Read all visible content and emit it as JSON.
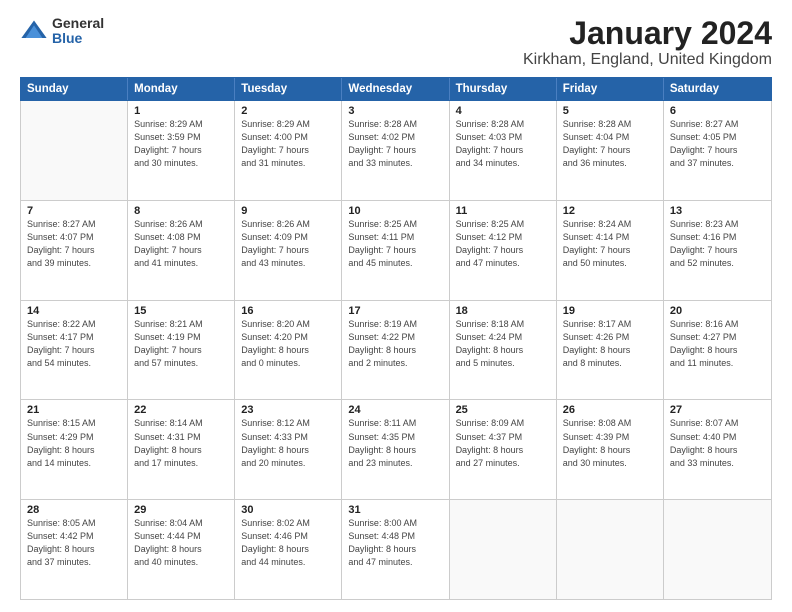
{
  "logo": {
    "general": "General",
    "blue": "Blue"
  },
  "title": "January 2024",
  "subtitle": "Kirkham, England, United Kingdom",
  "header_days": [
    "Sunday",
    "Monday",
    "Tuesday",
    "Wednesday",
    "Thursday",
    "Friday",
    "Saturday"
  ],
  "rows": [
    [
      {
        "day": "",
        "lines": []
      },
      {
        "day": "1",
        "lines": [
          "Sunrise: 8:29 AM",
          "Sunset: 3:59 PM",
          "Daylight: 7 hours",
          "and 30 minutes."
        ]
      },
      {
        "day": "2",
        "lines": [
          "Sunrise: 8:29 AM",
          "Sunset: 4:00 PM",
          "Daylight: 7 hours",
          "and 31 minutes."
        ]
      },
      {
        "day": "3",
        "lines": [
          "Sunrise: 8:28 AM",
          "Sunset: 4:02 PM",
          "Daylight: 7 hours",
          "and 33 minutes."
        ]
      },
      {
        "day": "4",
        "lines": [
          "Sunrise: 8:28 AM",
          "Sunset: 4:03 PM",
          "Daylight: 7 hours",
          "and 34 minutes."
        ]
      },
      {
        "day": "5",
        "lines": [
          "Sunrise: 8:28 AM",
          "Sunset: 4:04 PM",
          "Daylight: 7 hours",
          "and 36 minutes."
        ]
      },
      {
        "day": "6",
        "lines": [
          "Sunrise: 8:27 AM",
          "Sunset: 4:05 PM",
          "Daylight: 7 hours",
          "and 37 minutes."
        ]
      }
    ],
    [
      {
        "day": "7",
        "lines": [
          "Sunrise: 8:27 AM",
          "Sunset: 4:07 PM",
          "Daylight: 7 hours",
          "and 39 minutes."
        ]
      },
      {
        "day": "8",
        "lines": [
          "Sunrise: 8:26 AM",
          "Sunset: 4:08 PM",
          "Daylight: 7 hours",
          "and 41 minutes."
        ]
      },
      {
        "day": "9",
        "lines": [
          "Sunrise: 8:26 AM",
          "Sunset: 4:09 PM",
          "Daylight: 7 hours",
          "and 43 minutes."
        ]
      },
      {
        "day": "10",
        "lines": [
          "Sunrise: 8:25 AM",
          "Sunset: 4:11 PM",
          "Daylight: 7 hours",
          "and 45 minutes."
        ]
      },
      {
        "day": "11",
        "lines": [
          "Sunrise: 8:25 AM",
          "Sunset: 4:12 PM",
          "Daylight: 7 hours",
          "and 47 minutes."
        ]
      },
      {
        "day": "12",
        "lines": [
          "Sunrise: 8:24 AM",
          "Sunset: 4:14 PM",
          "Daylight: 7 hours",
          "and 50 minutes."
        ]
      },
      {
        "day": "13",
        "lines": [
          "Sunrise: 8:23 AM",
          "Sunset: 4:16 PM",
          "Daylight: 7 hours",
          "and 52 minutes."
        ]
      }
    ],
    [
      {
        "day": "14",
        "lines": [
          "Sunrise: 8:22 AM",
          "Sunset: 4:17 PM",
          "Daylight: 7 hours",
          "and 54 minutes."
        ]
      },
      {
        "day": "15",
        "lines": [
          "Sunrise: 8:21 AM",
          "Sunset: 4:19 PM",
          "Daylight: 7 hours",
          "and 57 minutes."
        ]
      },
      {
        "day": "16",
        "lines": [
          "Sunrise: 8:20 AM",
          "Sunset: 4:20 PM",
          "Daylight: 8 hours",
          "and 0 minutes."
        ]
      },
      {
        "day": "17",
        "lines": [
          "Sunrise: 8:19 AM",
          "Sunset: 4:22 PM",
          "Daylight: 8 hours",
          "and 2 minutes."
        ]
      },
      {
        "day": "18",
        "lines": [
          "Sunrise: 8:18 AM",
          "Sunset: 4:24 PM",
          "Daylight: 8 hours",
          "and 5 minutes."
        ]
      },
      {
        "day": "19",
        "lines": [
          "Sunrise: 8:17 AM",
          "Sunset: 4:26 PM",
          "Daylight: 8 hours",
          "and 8 minutes."
        ]
      },
      {
        "day": "20",
        "lines": [
          "Sunrise: 8:16 AM",
          "Sunset: 4:27 PM",
          "Daylight: 8 hours",
          "and 11 minutes."
        ]
      }
    ],
    [
      {
        "day": "21",
        "lines": [
          "Sunrise: 8:15 AM",
          "Sunset: 4:29 PM",
          "Daylight: 8 hours",
          "and 14 minutes."
        ]
      },
      {
        "day": "22",
        "lines": [
          "Sunrise: 8:14 AM",
          "Sunset: 4:31 PM",
          "Daylight: 8 hours",
          "and 17 minutes."
        ]
      },
      {
        "day": "23",
        "lines": [
          "Sunrise: 8:12 AM",
          "Sunset: 4:33 PM",
          "Daylight: 8 hours",
          "and 20 minutes."
        ]
      },
      {
        "day": "24",
        "lines": [
          "Sunrise: 8:11 AM",
          "Sunset: 4:35 PM",
          "Daylight: 8 hours",
          "and 23 minutes."
        ]
      },
      {
        "day": "25",
        "lines": [
          "Sunrise: 8:09 AM",
          "Sunset: 4:37 PM",
          "Daylight: 8 hours",
          "and 27 minutes."
        ]
      },
      {
        "day": "26",
        "lines": [
          "Sunrise: 8:08 AM",
          "Sunset: 4:39 PM",
          "Daylight: 8 hours",
          "and 30 minutes."
        ]
      },
      {
        "day": "27",
        "lines": [
          "Sunrise: 8:07 AM",
          "Sunset: 4:40 PM",
          "Daylight: 8 hours",
          "and 33 minutes."
        ]
      }
    ],
    [
      {
        "day": "28",
        "lines": [
          "Sunrise: 8:05 AM",
          "Sunset: 4:42 PM",
          "Daylight: 8 hours",
          "and 37 minutes."
        ]
      },
      {
        "day": "29",
        "lines": [
          "Sunrise: 8:04 AM",
          "Sunset: 4:44 PM",
          "Daylight: 8 hours",
          "and 40 minutes."
        ]
      },
      {
        "day": "30",
        "lines": [
          "Sunrise: 8:02 AM",
          "Sunset: 4:46 PM",
          "Daylight: 8 hours",
          "and 44 minutes."
        ]
      },
      {
        "day": "31",
        "lines": [
          "Sunrise: 8:00 AM",
          "Sunset: 4:48 PM",
          "Daylight: 8 hours",
          "and 47 minutes."
        ]
      },
      {
        "day": "",
        "lines": []
      },
      {
        "day": "",
        "lines": []
      },
      {
        "day": "",
        "lines": []
      }
    ]
  ]
}
